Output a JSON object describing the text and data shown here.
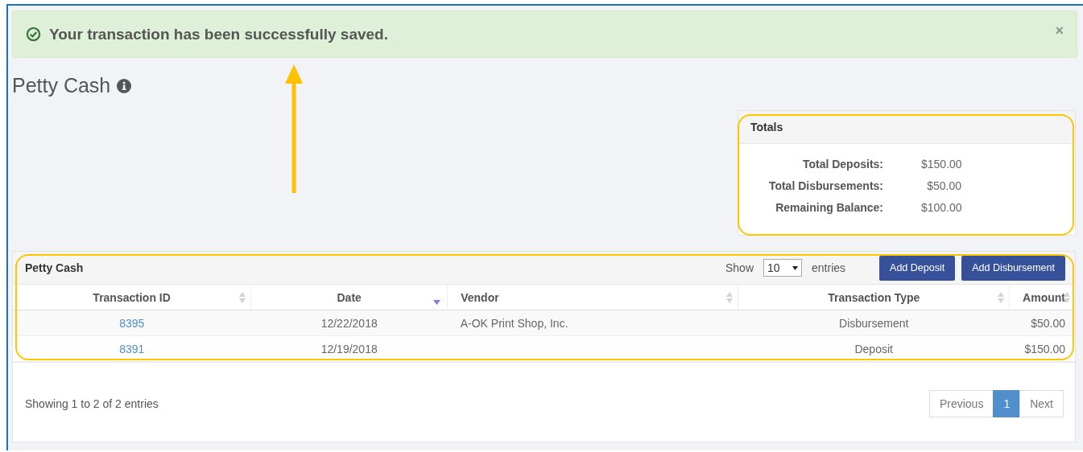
{
  "alert": {
    "message": "Your transaction has been successfully saved.",
    "close": "×"
  },
  "page_title": "Petty Cash",
  "callout_arrow": true,
  "totals": {
    "title": "Totals",
    "highlighted": true,
    "rows": [
      {
        "label": "Total Deposits:",
        "value": "$150.00"
      },
      {
        "label": "Total Disbursements:",
        "value": "$50.00"
      },
      {
        "label": "Remaining Balance:",
        "value": "$100.00"
      }
    ]
  },
  "table": {
    "title": "Petty Cash",
    "highlighted": true,
    "show_label": "Show",
    "page_size": "10",
    "entries_label": "entries",
    "buttons": [
      "Add Deposit",
      "Add Disbursement"
    ],
    "columns": [
      {
        "label": "Transaction ID",
        "sorted": false
      },
      {
        "label": "Date",
        "sorted": true
      },
      {
        "label": "Vendor",
        "sorted": false
      },
      {
        "label": "Transaction Type",
        "sorted": false
      },
      {
        "label": "Amount",
        "sorted": false
      }
    ],
    "rows": [
      [
        "8395",
        "12/22/2018",
        "A-OK Print Shop, Inc.",
        "Disbursement",
        "$50.00"
      ],
      [
        "8391",
        "12/19/2018",
        "",
        "Deposit",
        "$150.00"
      ]
    ],
    "info": "Showing 1 to 2 of 2 entries",
    "pagination": [
      {
        "label": "Previous",
        "selected": false
      },
      {
        "label": "1",
        "selected": true
      },
      {
        "label": "Next",
        "selected": false
      }
    ]
  }
}
